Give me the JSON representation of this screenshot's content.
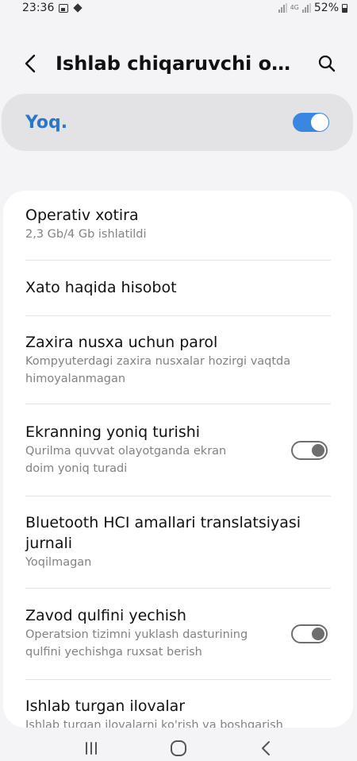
{
  "status_bar": {
    "time": "23:36",
    "battery": "52%",
    "network": "4G"
  },
  "header": {
    "title": "Ishlab chiqaruvchi opsiyalari"
  },
  "master_toggle": {
    "label": "Yoq.",
    "on": true
  },
  "items": [
    {
      "title": "Operativ xotira",
      "subtitle": "2,3 Gb/4 Gb ishlatildi"
    },
    {
      "title": "Xato haqida hisobot",
      "subtitle": ""
    },
    {
      "title": "Zaxira nusxa uchun parol",
      "subtitle": "Kompyuterdagi zaxira nusxalar hozirgi vaqtda himoyalanmagan"
    },
    {
      "title": "Ekranning yoniq turishi",
      "subtitle": "Qurilma quvvat olayotganda ekran doim yoniq turadi",
      "toggle": false
    },
    {
      "title": "Bluetooth HCI amallari translatsiyasi jurnali",
      "subtitle": "Yoqilmagan"
    },
    {
      "title": "Zavod qulfini yechish",
      "subtitle": "Operatsion tizimni yuklash dasturining qulfini yechishga ruxsat berish",
      "toggle": false
    },
    {
      "title": "Ishlab turgan ilovalar",
      "subtitle": "Ishlab turgan ilovalarni ko'rish va boshqarish"
    }
  ],
  "colors": {
    "accent": "#3b86e0",
    "master_label": "#2a77c9",
    "background": "#f4f4f6",
    "card": "#ffffff",
    "subtitle": "#828282"
  },
  "icons": {
    "back": "chevron-left-icon",
    "search": "search-icon",
    "nav_recents": "recents-icon",
    "nav_home": "home-icon",
    "nav_back": "back-icon"
  }
}
